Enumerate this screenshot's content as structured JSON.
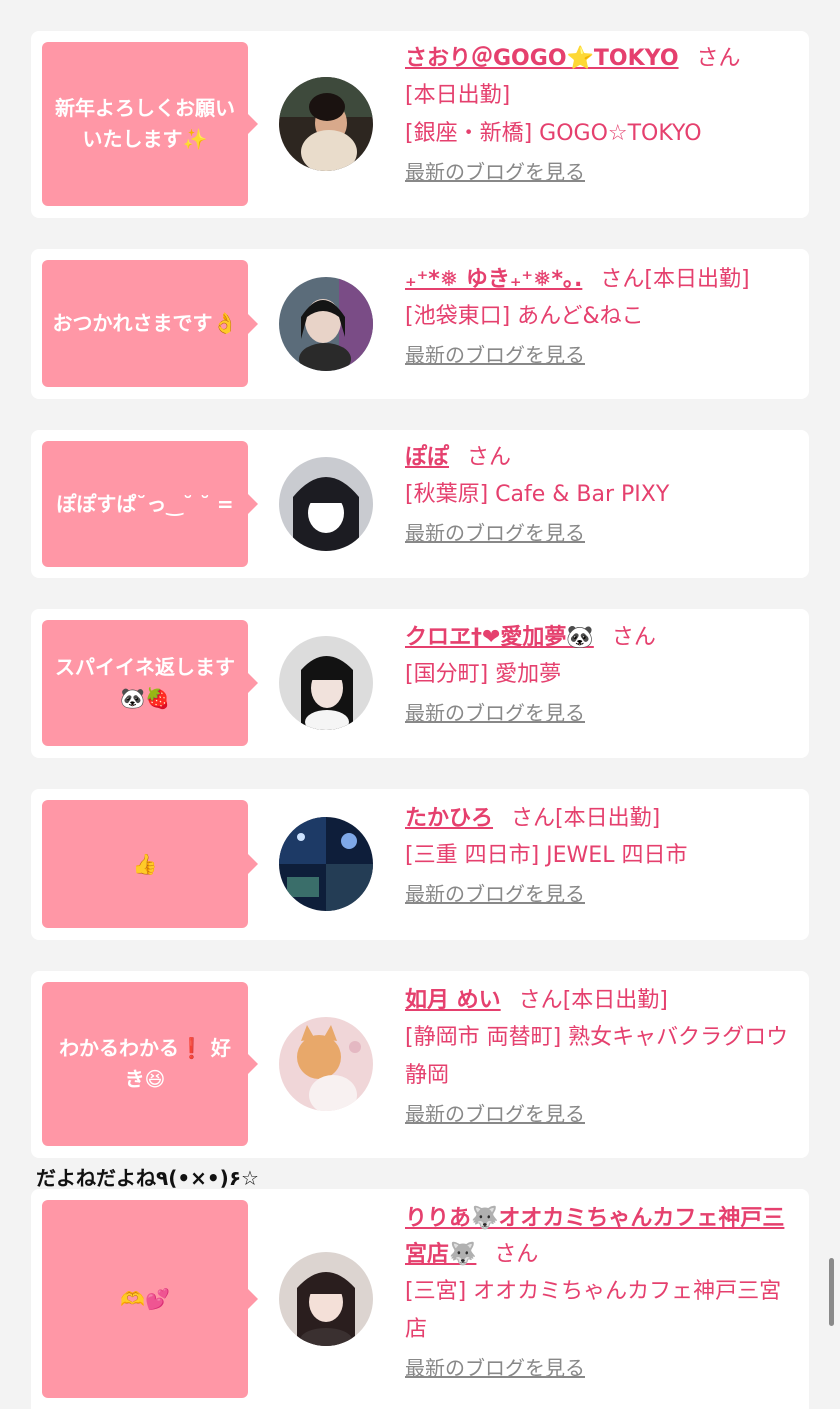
{
  "blog_label": "最新のブログを見る",
  "san_label": "さん",
  "entries": [
    {
      "bubble_text": "新年よろしくお願いいたします✨",
      "name": "さおり＠GOGO⭐TOKYO",
      "status": "",
      "line1": "[本日出勤]",
      "line2": "[銀座・新橋] GOGO☆TOKYO"
    },
    {
      "bubble_text": "おつかれさまです👌",
      "name": "₊⁺*❅ ゆき₊⁺❅*｡.",
      "status": "[本日出勤]",
      "line1": "[池袋東口] あんど&ねこ",
      "line2": ""
    },
    {
      "bubble_text": "ぽぽすぱ˘っ‿˘ ˘ =",
      "name": "ぽぽ",
      "status": "",
      "line1": "[秋葉原] Cafe & Bar PIXY",
      "line2": ""
    },
    {
      "bubble_text": "スパイイネ返します🐼🍓",
      "name": "クロヱ†❤愛加夢🐼",
      "status": "",
      "line1": "[国分町] 愛加夢",
      "line2": ""
    },
    {
      "bubble_text": "👍",
      "name": "たかひろ",
      "status": "[本日出勤]",
      "line1": "[三重 四日市] JEWEL 四日市",
      "line2": ""
    },
    {
      "bubble_text": "わかるわかる❗ 好き😆",
      "name": "如月 めい",
      "status": "[本日出勤]",
      "line1": "[静岡市 両替町] 熟女キャバクラグロウ静岡",
      "line2": ""
    },
    {
      "bubble_text": "🫶💕",
      "name": "りりあ🐺オオカミちゃんカフェ神戸三宮店🐺",
      "status": "",
      "line1": "[三宮] オオカミちゃんカフェ神戸三宮店",
      "line2": ""
    }
  ],
  "loose_text": "だよねだよね٩(•×•)۶☆",
  "colors": {
    "accent": "#e5406e",
    "bubble": "#ff97a6",
    "background": "#f3f3f3",
    "card": "#ffffff",
    "muted": "#888888"
  }
}
